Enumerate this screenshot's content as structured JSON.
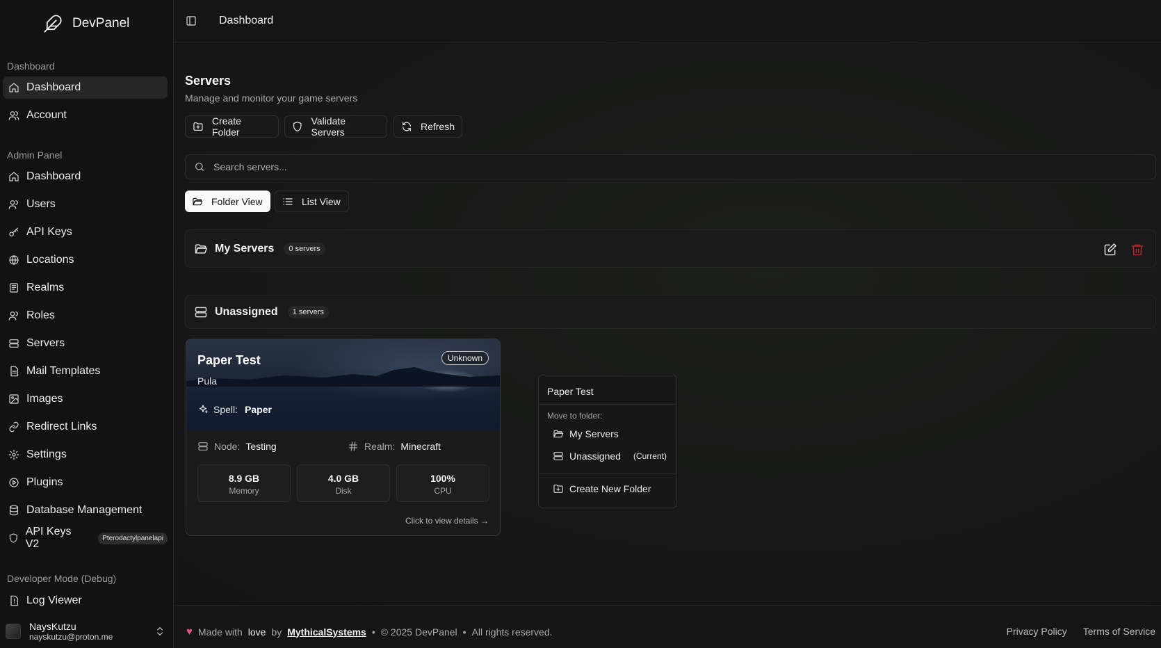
{
  "app": {
    "name": "DevPanel"
  },
  "topbar": {
    "breadcrumb": "Dashboard"
  },
  "sidebar": {
    "sections": {
      "dashboard": "Dashboard",
      "admin": "Admin Panel",
      "developer": "Developer Mode (Debug)"
    },
    "dashboard_items": [
      "Dashboard",
      "Account"
    ],
    "admin_items": [
      "Dashboard",
      "Users",
      "API Keys",
      "Locations",
      "Realms",
      "Roles",
      "Servers",
      "Mail Templates",
      "Images",
      "Redirect Links",
      "Settings",
      "Plugins",
      "Database Management",
      "API Keys V2"
    ],
    "api_keys_v2_badge": "Pterodactylpanelapi",
    "developer_items": [
      "Log Viewer"
    ],
    "user": {
      "name": "NaysKutzu",
      "email": "nayskutzu@proton.me"
    }
  },
  "page": {
    "title": "Servers",
    "subtitle": "Manage and monitor your game servers",
    "actions": {
      "create_folder": "Create Folder",
      "validate": "Validate Servers",
      "refresh": "Refresh"
    },
    "search": {
      "placeholder": "Search servers...",
      "value": ""
    },
    "views": {
      "folder": "Folder View",
      "list": "List View",
      "active": "folder"
    }
  },
  "folders": [
    {
      "name": "My Servers",
      "count": "0 servers"
    },
    {
      "name": "Unassigned",
      "count": "1 servers"
    }
  ],
  "server_card": {
    "name": "Paper Test",
    "location": "Pula",
    "status": "Unknown",
    "spell_label": "Spell:",
    "spell": "Paper",
    "node_label": "Node:",
    "node": "Testing",
    "realm_label": "Realm:",
    "realm": "Minecraft",
    "stats": [
      {
        "value": "8.9 GB",
        "label": "Memory"
      },
      {
        "value": "4.0 GB",
        "label": "Disk"
      },
      {
        "value": "100%",
        "label": "CPU"
      }
    ],
    "footer": "Click to view details →"
  },
  "context_menu": {
    "title": "Paper Test",
    "move_label": "Move to folder:",
    "items": [
      "My Servers",
      "Unassigned"
    ],
    "current_tag": "(Current)",
    "create": "Create New Folder"
  },
  "footer": {
    "made_with": "Made with",
    "love": "love",
    "by": "by",
    "company": "MythicalSystems",
    "copyright": "© 2025 DevPanel",
    "rights": "All rights reserved.",
    "links": [
      "Privacy Policy",
      "Terms of Service"
    ]
  },
  "colors": {
    "delete": "#b3262f",
    "heart": "#e0567a",
    "accent_bg": "#fafafa"
  }
}
